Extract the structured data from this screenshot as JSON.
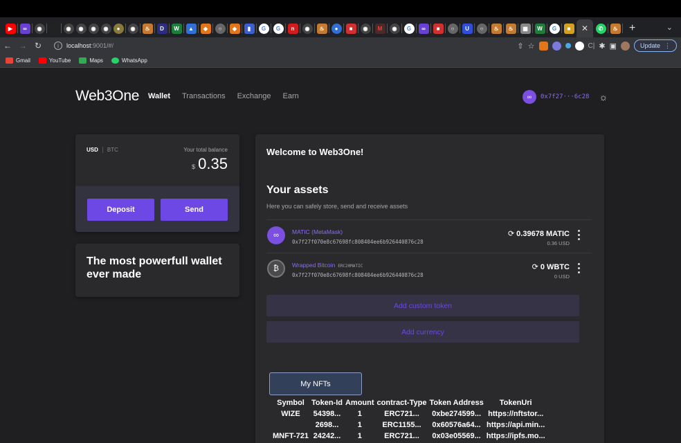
{
  "browser": {
    "url_host": "localhost",
    "url_rest": ":9001/#/",
    "update_label": "Update",
    "bookmarks": [
      {
        "label": "Gmail",
        "color": "#ea4335"
      },
      {
        "label": "YouTube",
        "color": "#ff0000"
      },
      {
        "label": "Maps",
        "color": "#34a853"
      },
      {
        "label": "WhatsApp",
        "color": "#25d366"
      }
    ]
  },
  "header": {
    "logo": "Web3One",
    "nav": [
      "Wallet",
      "Transactions",
      "Exchange",
      "Earn"
    ],
    "account_address": "0x7f27···6c28"
  },
  "balance": {
    "currency_active": "USD",
    "currency_other": "BTC",
    "label": "Your total balance",
    "symbol": "$",
    "amount": "0.35",
    "deposit_label": "Deposit",
    "send_label": "Send"
  },
  "promo": {
    "text": "The most powerfull wallet ever made"
  },
  "main": {
    "welcome": "Welcome to Web3One!",
    "assets_title": "Your assets",
    "assets_subtitle": "Here you can safely store, send and receive assets",
    "assets": [
      {
        "name": "MATIC (MetaMask)",
        "tag": "",
        "address": "0x7f27f070e8c67698fc808404ee6b926440876c28",
        "balance": "0.39678 MATIC",
        "usd": "0.36 USD"
      },
      {
        "name": "Wrapped Bitcoin",
        "tag": "ERC20MATIC",
        "address": "0x7f27f070e8c67698fc808404ee6b926440876c28",
        "balance": "0 WBTC",
        "usd": "0 USD"
      }
    ],
    "add_token_label": "Add custom token",
    "add_currency_label": "Add currency"
  },
  "nfts": {
    "button_label": "My NFTs",
    "columns": [
      "Symbol",
      "Token-Id",
      "Amount",
      "contract-Type",
      "Token Address",
      "TokenUri"
    ],
    "rows": [
      [
        "WIZE",
        "54398...",
        "1",
        "ERC721...",
        "0xbe274599...",
        "https://nftstor..."
      ],
      [
        "",
        "2698...",
        "1",
        "ERC1155...",
        "0x60576a64...",
        "https://api.min..."
      ],
      [
        "MNFT-721",
        "24242...",
        "1",
        "ERC721...",
        "0x03e05569...",
        "https://ipfs.mo..."
      ]
    ]
  },
  "colors": {
    "accent": "#6e48e4",
    "background": "#1f1f21",
    "card": "#2a2a2d"
  }
}
